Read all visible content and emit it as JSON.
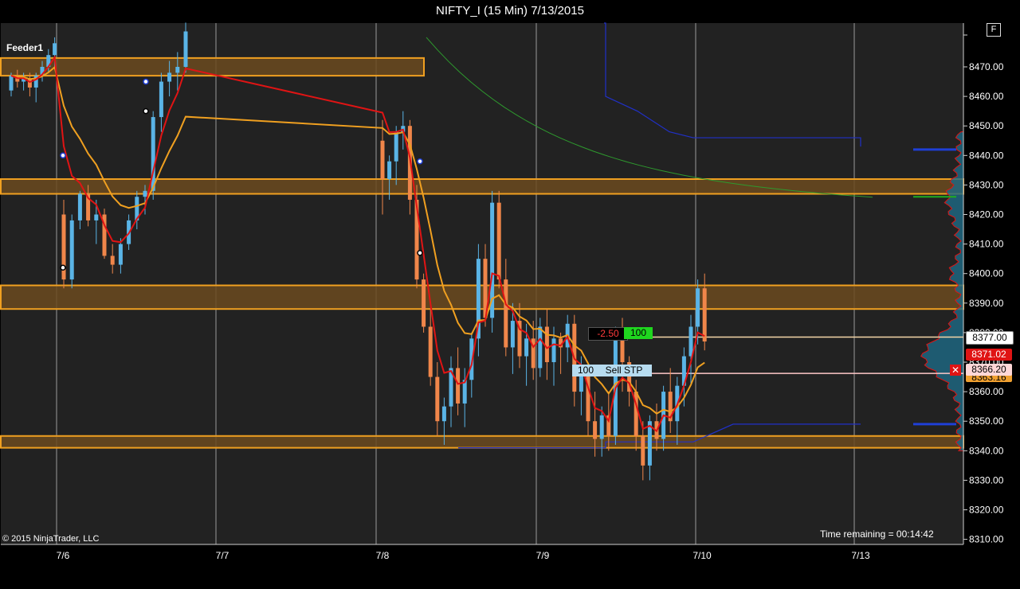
{
  "window": {
    "title": "NIFTY_I (15 Min)  7/13/2015",
    "f_button": "F"
  },
  "overlays": {
    "feeder_label": "Feeder1",
    "copyright": "© 2015 NinjaTrader, LLC",
    "time_remaining": "Time remaining = 00:14:42"
  },
  "orders": {
    "working_pnl": "-2.50",
    "working_qty": "100",
    "stop_qty": "100",
    "stop_label": "Sell STP"
  },
  "price_markers": {
    "last_price": "8377.00",
    "red_marker": "8371.02",
    "stop_price": "8366.20",
    "orange_marker": "8363.16"
  },
  "colors": {
    "background": "#222222",
    "up_candle": "#5ab4e6",
    "down_candle": "#f0864a",
    "zone_fill": "#6b4a1e",
    "zone_border": "#f0a020",
    "fast_ma": "#e01414",
    "slow_ma": "#f0a020",
    "profile": "#1e6a86",
    "profile_edge": "#e01414"
  },
  "chart_data": {
    "type": "candlestick",
    "y_axis": {
      "min": 8310,
      "max": 8470,
      "step": 10,
      "ticks": [
        "8470.00",
        "8460.00",
        "8450.00",
        "8440.00",
        "8430.00",
        "8420.00",
        "8410.00",
        "8400.00",
        "8390.00",
        "8380.00",
        "8370.00",
        "8360.00",
        "8350.00",
        "8340.00",
        "8330.00",
        "8320.00",
        "8310.00"
      ]
    },
    "x_axis": {
      "labels": [
        "7/6",
        "7/7",
        "7/8",
        "7/9",
        "7/10",
        "7/13"
      ]
    },
    "zones": [
      {
        "from": 8467,
        "to": 8473
      },
      {
        "from": 8427,
        "to": 8432
      },
      {
        "from": 8388,
        "to": 8396
      },
      {
        "from": 8341,
        "to": 8345
      }
    ],
    "candles": [
      [
        8462,
        8468,
        8460,
        8467
      ],
      [
        8467,
        8469,
        8463,
        8465
      ],
      [
        8465,
        8468,
        8462,
        8466
      ],
      [
        8466,
        8468,
        8460,
        8463
      ],
      [
        8463,
        8468,
        8458,
        8467
      ],
      [
        8467,
        8472,
        8465,
        8470
      ],
      [
        8470,
        8476,
        8468,
        8474
      ],
      [
        8474,
        8480,
        8470,
        8478
      ],
      [
        8420,
        8425,
        8395,
        8398
      ],
      [
        8398,
        8420,
        8395,
        8418
      ],
      [
        8418,
        8428,
        8415,
        8427
      ],
      [
        8427,
        8430,
        8416,
        8418
      ],
      [
        8418,
        8425,
        8410,
        8420
      ],
      [
        8420,
        8422,
        8405,
        8406
      ],
      [
        8406,
        8410,
        8400,
        8403
      ],
      [
        8403,
        8412,
        8400,
        8410
      ],
      [
        8410,
        8420,
        8408,
        8418
      ],
      [
        8418,
        8428,
        8415,
        8426
      ],
      [
        8426,
        8430,
        8420,
        8428
      ],
      [
        8428,
        8455,
        8425,
        8453
      ],
      [
        8453,
        8468,
        8448,
        8465
      ],
      [
        8465,
        8472,
        8460,
        8468
      ],
      [
        8468,
        8475,
        8462,
        8470
      ],
      [
        8470,
        8485,
        8468,
        8482
      ],
      [
        8445,
        8452,
        8420,
        8432
      ],
      [
        8432,
        8440,
        8425,
        8438
      ],
      [
        8438,
        8450,
        8430,
        8448
      ],
      [
        8448,
        8455,
        8442,
        8450
      ],
      [
        8450,
        8452,
        8420,
        8425
      ],
      [
        8425,
        8430,
        8395,
        8398
      ],
      [
        8398,
        8400,
        8380,
        8382
      ],
      [
        8382,
        8388,
        8362,
        8365
      ],
      [
        8365,
        8370,
        8345,
        8350
      ],
      [
        8350,
        8358,
        8342,
        8355
      ],
      [
        8355,
        8372,
        8348,
        8368
      ],
      [
        8368,
        8375,
        8352,
        8356
      ],
      [
        8356,
        8368,
        8348,
        8364
      ],
      [
        8364,
        8380,
        8358,
        8378
      ],
      [
        8378,
        8410,
        8372,
        8405
      ],
      [
        8405,
        8410,
        8382,
        8385
      ],
      [
        8385,
        8428,
        8380,
        8424
      ],
      [
        8424,
        8428,
        8395,
        8398
      ],
      [
        8398,
        8405,
        8372,
        8375
      ],
      [
        8375,
        8390,
        8366,
        8384
      ],
      [
        8384,
        8390,
        8368,
        8372
      ],
      [
        8372,
        8383,
        8362,
        8378
      ],
      [
        8378,
        8384,
        8364,
        8368
      ],
      [
        8368,
        8385,
        8365,
        8382
      ],
      [
        8382,
        8388,
        8364,
        8370
      ],
      [
        8370,
        8382,
        8362,
        8378
      ],
      [
        8378,
        8380,
        8366,
        8375
      ],
      [
        8375,
        8386,
        8370,
        8383
      ],
      [
        8383,
        8386,
        8355,
        8360
      ],
      [
        8360,
        8372,
        8352,
        8366
      ],
      [
        8366,
        8368,
        8345,
        8350
      ],
      [
        8350,
        8360,
        8338,
        8344
      ],
      [
        8344,
        8355,
        8338,
        8352
      ],
      [
        8352,
        8360,
        8340,
        8345
      ],
      [
        8345,
        8382,
        8342,
        8378
      ],
      [
        8378,
        8385,
        8360,
        8370
      ],
      [
        8370,
        8372,
        8355,
        8360
      ],
      [
        8360,
        8364,
        8340,
        8345
      ],
      [
        8345,
        8350,
        8330,
        8335
      ],
      [
        8335,
        8352,
        8330,
        8350
      ],
      [
        8350,
        8356,
        8340,
        8344
      ],
      [
        8344,
        8362,
        8340,
        8360
      ],
      [
        8360,
        8368,
        8346,
        8350
      ],
      [
        8350,
        8365,
        8342,
        8362
      ],
      [
        8362,
        8375,
        8355,
        8372
      ],
      [
        8372,
        8386,
        8362,
        8382
      ],
      [
        8382,
        8398,
        8376,
        8395
      ],
      [
        8395,
        8400,
        8374,
        8377
      ]
    ],
    "markers_y": [
      8465,
      8455,
      8438,
      8407,
      8440,
      8402
    ]
  }
}
